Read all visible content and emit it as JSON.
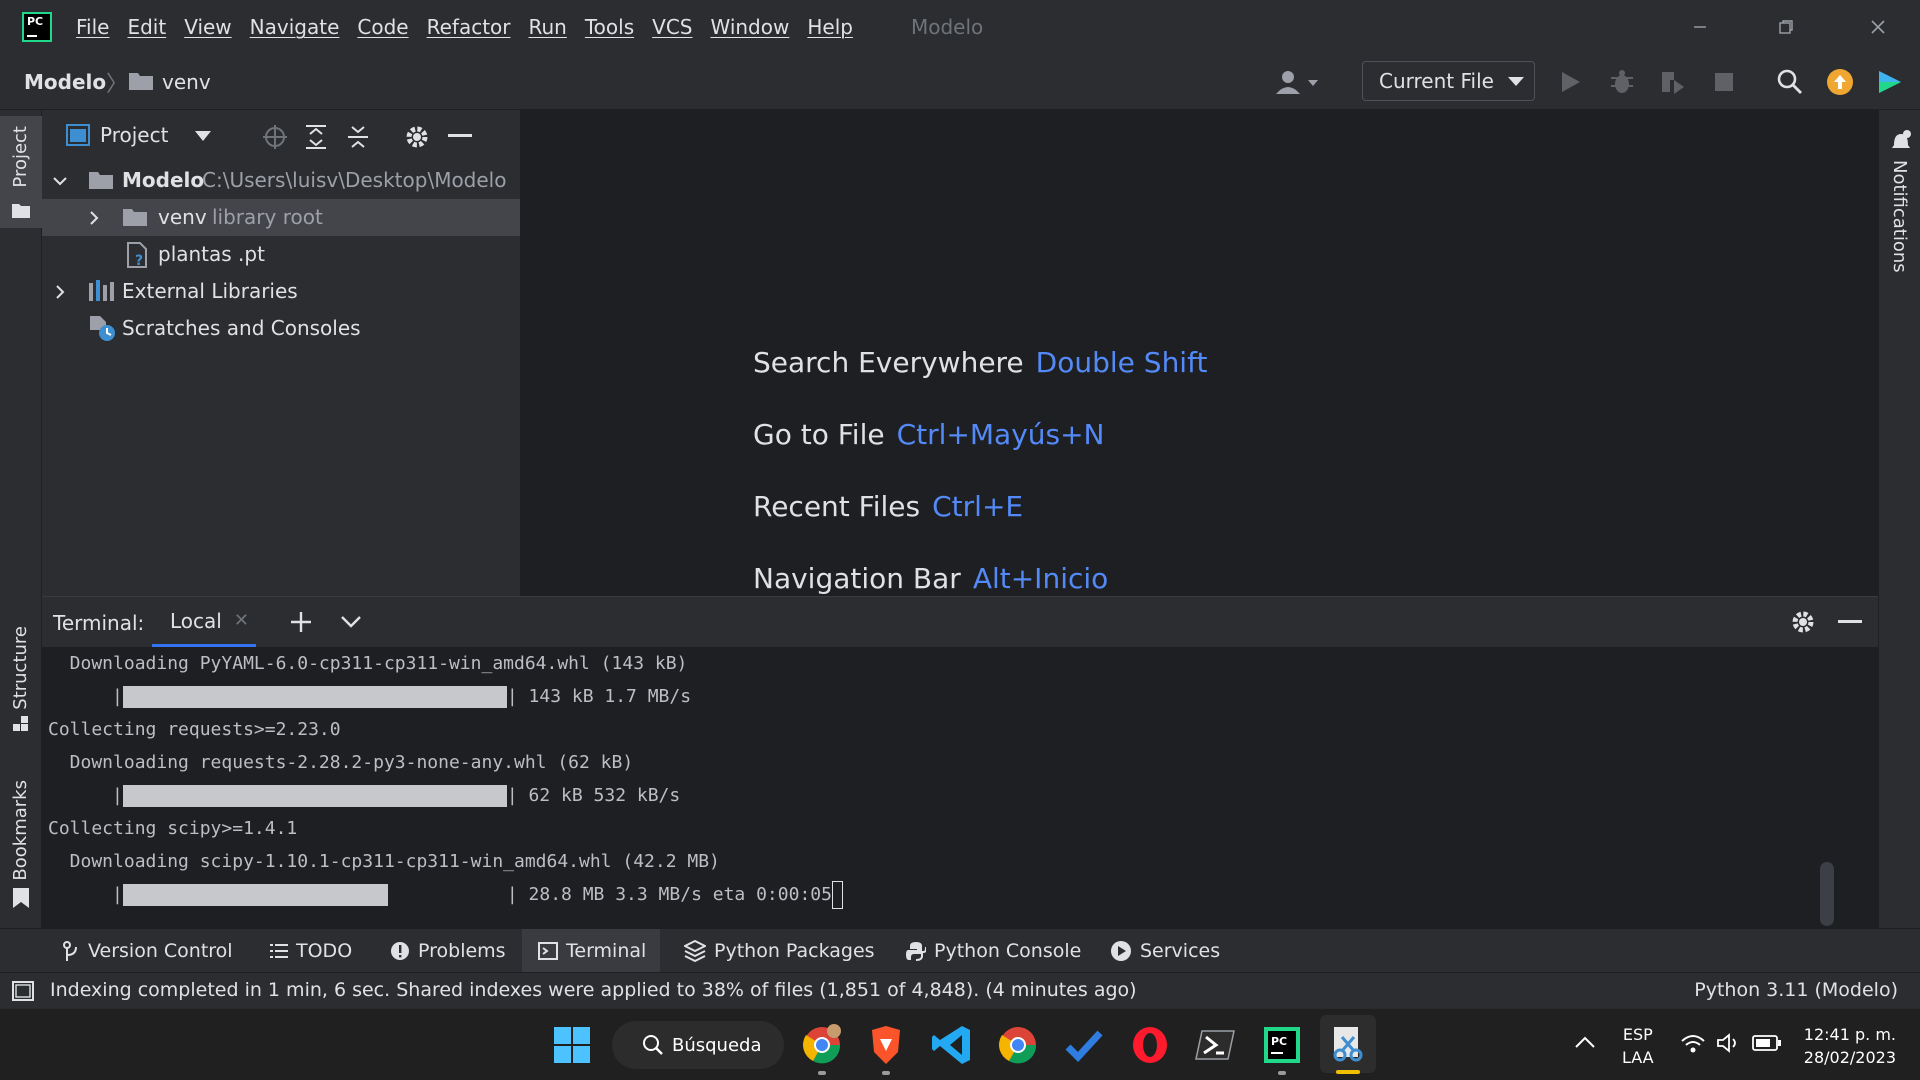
{
  "window": {
    "title": "Modelo",
    "menu": [
      "File",
      "Edit",
      "View",
      "Navigate",
      "Code",
      "Refactor",
      "Run",
      "Tools",
      "VCS",
      "Window",
      "Help"
    ]
  },
  "navbar": {
    "project": "Modelo",
    "folder": "venv",
    "run_config": "Current File"
  },
  "left_stripe": {
    "project": "Project",
    "structure": "Structure",
    "bookmarks": "Bookmarks"
  },
  "right_stripe": {
    "notifications": "Notifications"
  },
  "project_panel": {
    "title": "Project",
    "tree": [
      {
        "label": "Modelo",
        "hint": "C:\\Users\\luisv\\Desktop\\Modelo"
      },
      {
        "label": "venv",
        "hint": "library root"
      },
      {
        "label": "plantas .pt"
      },
      {
        "label": "External Libraries"
      },
      {
        "label": "Scratches and Consoles"
      }
    ]
  },
  "editor_hints": [
    {
      "action": "Search Everywhere",
      "shortcut": "Double Shift"
    },
    {
      "action": "Go to File",
      "shortcut": "Ctrl+Mayús+N"
    },
    {
      "action": "Recent Files",
      "shortcut": "Ctrl+E"
    },
    {
      "action": "Navigation Bar",
      "shortcut": "Alt+Inicio"
    }
  ],
  "terminal": {
    "label": "Terminal:",
    "tab": "Local",
    "lines": [
      "  Downloading PyYAML-6.0-cp311-cp311-win_amd64.whl (143 kB)",
      "| 143 kB 1.7 MB/s",
      "Collecting requests>=2.23.0",
      "  Downloading requests-2.28.2-py3-none-any.whl (62 kB)",
      "| 62 kB 532 kB/s",
      "Collecting scipy>=1.4.1",
      "  Downloading scipy-1.10.1-cp311-cp311-win_amd64.whl (42.2 MB)",
      "| 28.8 MB 3.3 MB/s eta 0:00:05"
    ],
    "progress": [
      1.0,
      1.0,
      0.69
    ]
  },
  "tool_tabs": [
    "Version Control",
    "TODO",
    "Problems",
    "Terminal",
    "Python Packages",
    "Python Console",
    "Services"
  ],
  "status": {
    "message": "Indexing completed in 1 min, 6 sec. Shared indexes were applied to 38% of files (1,851 of 4,848). (4 minutes ago)",
    "interpreter": "Python 3.11 (Modelo)"
  },
  "taskbar": {
    "search": "Búsqueda",
    "lang_top": "ESP",
    "lang_bottom": "LAA",
    "time": "12:41 p. m.",
    "date": "28/02/2023"
  },
  "colors": {
    "accent": "#3574f0",
    "shortcut": "#548af7",
    "bg": "#1e1f22",
    "panel": "#2b2d30"
  }
}
